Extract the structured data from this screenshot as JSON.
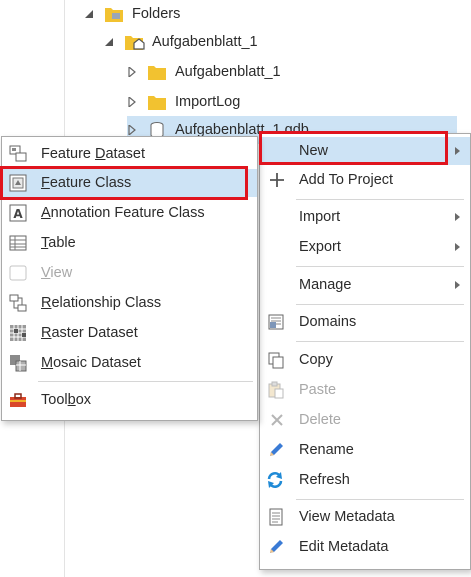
{
  "catalog_tree": {
    "items": [
      {
        "label": "Folders",
        "icon": "folder-connections-icon",
        "expanded": true
      },
      {
        "label": "Aufgabenblatt_1",
        "icon": "home-folder-icon",
        "expanded": true
      },
      {
        "label": "Aufgabenblatt_1",
        "icon": "folder-icon",
        "expanded": false
      },
      {
        "label": "ImportLog",
        "icon": "folder-icon",
        "expanded": false
      },
      {
        "label": "Aufgabenblatt_1.gdb",
        "icon": "geodatabase-icon",
        "expanded": false
      }
    ]
  },
  "context_menu": {
    "new": {
      "label": "New",
      "has_submenu": true
    },
    "add_to_project": {
      "label": "Add To Project"
    },
    "import": {
      "label": "Import",
      "has_submenu": true
    },
    "export": {
      "label": "Export",
      "has_submenu": true
    },
    "manage": {
      "label": "Manage",
      "has_submenu": true
    },
    "domains": {
      "label": "Domains"
    },
    "copy": {
      "label": "Copy"
    },
    "paste": {
      "label": "Paste",
      "disabled": true
    },
    "delete": {
      "label": "Delete",
      "disabled": true
    },
    "rename": {
      "label": "Rename"
    },
    "refresh": {
      "label": "Refresh"
    },
    "view_metadata": {
      "label": "View Metadata"
    },
    "edit_metadata": {
      "label": "Edit Metadata"
    }
  },
  "new_submenu": {
    "feature_dataset": {
      "pre": "Feature ",
      "u": "D",
      "post": "ataset"
    },
    "feature_class": {
      "pre": "",
      "u": "F",
      "post": "eature Class"
    },
    "annotation_feature_class": {
      "pre": "",
      "u": "A",
      "post": "nnotation Feature Class"
    },
    "table": {
      "pre": "",
      "u": "T",
      "post": "able"
    },
    "view": {
      "pre": "",
      "u": "V",
      "post": "iew",
      "disabled": true
    },
    "relationship_class": {
      "pre": "",
      "u": "R",
      "post": "elationship Class"
    },
    "raster_dataset": {
      "pre": "",
      "u": "R",
      "post": "aster Dataset"
    },
    "mosaic_dataset": {
      "pre": "",
      "u": "M",
      "post": "osaic Dataset"
    },
    "toolbox": {
      "pre": "Tool",
      "u": "b",
      "post": "ox"
    }
  },
  "colors": {
    "highlight": "#cde3f5",
    "annotation_red": "#e0141e",
    "folder_yellow": "#f2c230",
    "accent_blue": "#1f6fbf"
  }
}
